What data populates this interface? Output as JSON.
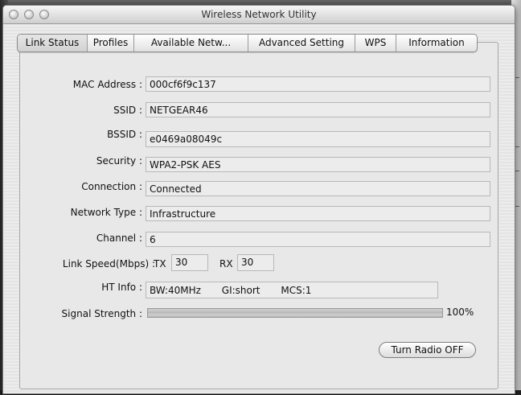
{
  "window": {
    "title": "Wireless Network Utility"
  },
  "tabs": [
    {
      "label": "Link Status",
      "active": true
    },
    {
      "label": "Profiles"
    },
    {
      "label": "Available Netw..."
    },
    {
      "label": "Advanced Setting"
    },
    {
      "label": "WPS"
    },
    {
      "label": "Information"
    }
  ],
  "fields": {
    "mac": {
      "label": "MAC Address :",
      "value": "000cf6f9c137"
    },
    "ssid": {
      "label": "SSID :",
      "value": "NETGEAR46"
    },
    "bssid": {
      "label": "BSSID :",
      "value": "e0469a08049c"
    },
    "security": {
      "label": "Security :",
      "value": "WPA2-PSK AES"
    },
    "connection": {
      "label": "Connection :",
      "value": "Connected"
    },
    "network_type": {
      "label": "Network Type :",
      "value": "Infrastructure"
    },
    "channel": {
      "label": "Channel :",
      "value": "6"
    }
  },
  "link_speed": {
    "label": "Link Speed(Mbps) :",
    "tx_label": "TX",
    "tx_value": "30",
    "rx_label": "RX",
    "rx_value": "30"
  },
  "ht_info": {
    "label": "HT Info :",
    "bw": "BW:40MHz",
    "gi": "GI:short",
    "mcs": "MCS:1"
  },
  "signal": {
    "label": "Signal Strength :",
    "percent_text": "100%",
    "level": 100
  },
  "button": {
    "label": "Turn Radio OFF"
  }
}
